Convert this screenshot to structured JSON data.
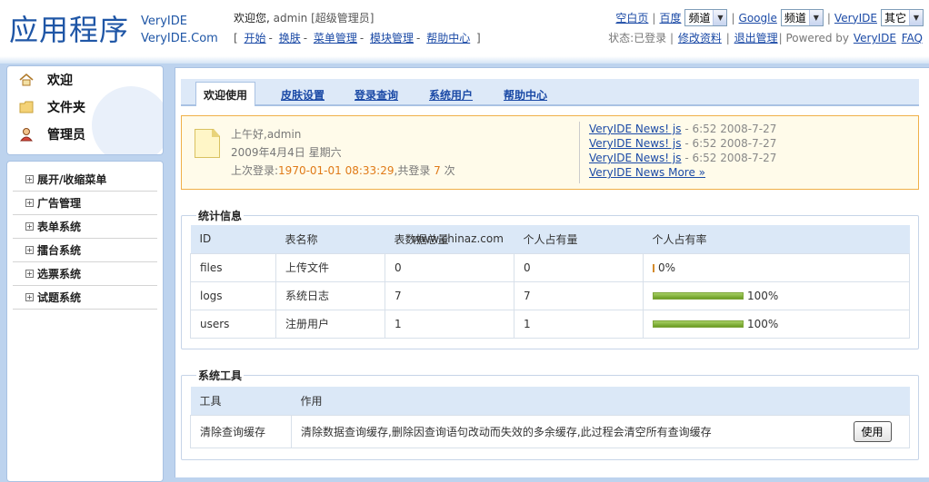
{
  "header": {
    "logo": "应用程序",
    "logo_sub1": "VeryIDE",
    "logo_sub2": "VeryIDE.Com",
    "welcome_prefix": "欢迎您,",
    "user": "admin",
    "role": "[超级管理员]",
    "nav_open": "[",
    "nav_close": "]",
    "nav_links": [
      "开始",
      "换肤",
      "菜单管理",
      "模块管理",
      "帮助中心"
    ],
    "toolbar": {
      "blank_page": "空白页",
      "baidu": "百度",
      "baidu_select": "频道",
      "google": "Google",
      "google_select": "频道",
      "veryide": "VeryIDE",
      "veryide_select": "其它"
    },
    "status_label": "状态:已登录",
    "edit_profile": "修改资料",
    "logout": "退出管理",
    "powered_by": "| Powered by",
    "powered_link": "VeryIDE",
    "faq": "FAQ"
  },
  "sidebar": {
    "top_items": [
      {
        "label": "欢迎",
        "icon": "home-icon"
      },
      {
        "label": "文件夹",
        "icon": "folder-icon"
      },
      {
        "label": "管理员",
        "icon": "user-icon"
      }
    ],
    "menu_items": [
      "展开/收缩菜单",
      "广告管理",
      "表单系统",
      "擂台系统",
      "选票系统",
      "试题系统"
    ]
  },
  "tabs": [
    "欢迎使用",
    "皮肤设置",
    "登录查询",
    "系统用户",
    "帮助中心"
  ],
  "notice": {
    "greeting": "上午好,admin",
    "date": "2009年4月4日 星期六",
    "last_login_label": "上次登录:",
    "last_login_time": "1970-01-01 08:33:29",
    "count_prefix": ",共登录",
    "count": "7",
    "count_suffix": "次",
    "news": [
      {
        "title": "VeryIDE News! js",
        "time": "- 6:52 2008-7-27"
      },
      {
        "title": "VeryIDE News! js",
        "time": "- 6:52 2008-7-27"
      },
      {
        "title": "VeryIDE News! js",
        "time": "- 6:52 2008-7-27"
      }
    ],
    "news_more": "VeryIDE News More »"
  },
  "stats": {
    "legend": "统计信息",
    "headers": [
      "ID",
      "表名称",
      "表数据总量",
      "个人占有量",
      "个人占有率"
    ],
    "watermark": "www.chinaz.com",
    "rows": [
      {
        "id": "files",
        "name": "上传文件",
        "total": "0",
        "own": "0",
        "rate": "0%",
        "rate_value": 0
      },
      {
        "id": "logs",
        "name": "系统日志",
        "total": "7",
        "own": "7",
        "rate": "100%",
        "rate_value": 100
      },
      {
        "id": "users",
        "name": "注册用户",
        "total": "1",
        "own": "1",
        "rate": "100%",
        "rate_value": 100
      }
    ]
  },
  "tools": {
    "legend": "系统工具",
    "headers": [
      "工具",
      "作用"
    ],
    "rows": [
      {
        "tool": "清除查询缓存",
        "desc": "清除数据查询缓存,删除因查询语句改动而失效的多余缓存,此过程会清空所有查询缓存",
        "action": "使用"
      }
    ]
  }
}
